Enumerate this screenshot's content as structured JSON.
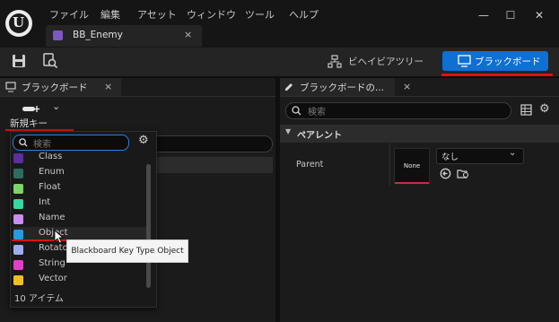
{
  "menu": [
    "ファイル",
    "編集",
    "アセット",
    "ウィンドウ",
    "ツール",
    "ヘルプ"
  ],
  "window_controls": {
    "minimize": "—",
    "maximize": "☐",
    "close": "✕"
  },
  "document_tab": {
    "label": "BB_Enemy",
    "close": "×"
  },
  "toolbar": {
    "behavior_tree_label": "ビヘイビアツリー",
    "blackboard_label": "ブラックボード"
  },
  "left_panel": {
    "title": "ブラックボード",
    "close": "×",
    "new_key_label": "新規キー",
    "new_key_chevron": "⌄"
  },
  "dropdown": {
    "search_placeholder": "検索",
    "items": [
      {
        "name": "Class",
        "color": "#5b2fa0"
      },
      {
        "name": "Enum",
        "color": "#2e6b60"
      },
      {
        "name": "Float",
        "color": "#7dd46a"
      },
      {
        "name": "Int",
        "color": "#38d6a0"
      },
      {
        "name": "Name",
        "color": "#c98ef0"
      },
      {
        "name": "Object",
        "color": "#2a9ae0"
      },
      {
        "name": "Rotator",
        "color": "#9eaef0"
      },
      {
        "name": "String",
        "color": "#e040c8"
      },
      {
        "name": "Vector",
        "color": "#f0c020"
      }
    ],
    "count_label": "10 アイテム",
    "tooltip": "Blackboard Key Type Object"
  },
  "right_panel": {
    "title": "ブラックボードの...",
    "close": "×",
    "search_placeholder": "検索",
    "category": "ペアレント",
    "parent_label": "Parent",
    "none_thumbnail": "None",
    "select_value": "なし"
  },
  "accent_colors": {
    "primary": "#0e6fd4",
    "annotation": "#e01010"
  }
}
